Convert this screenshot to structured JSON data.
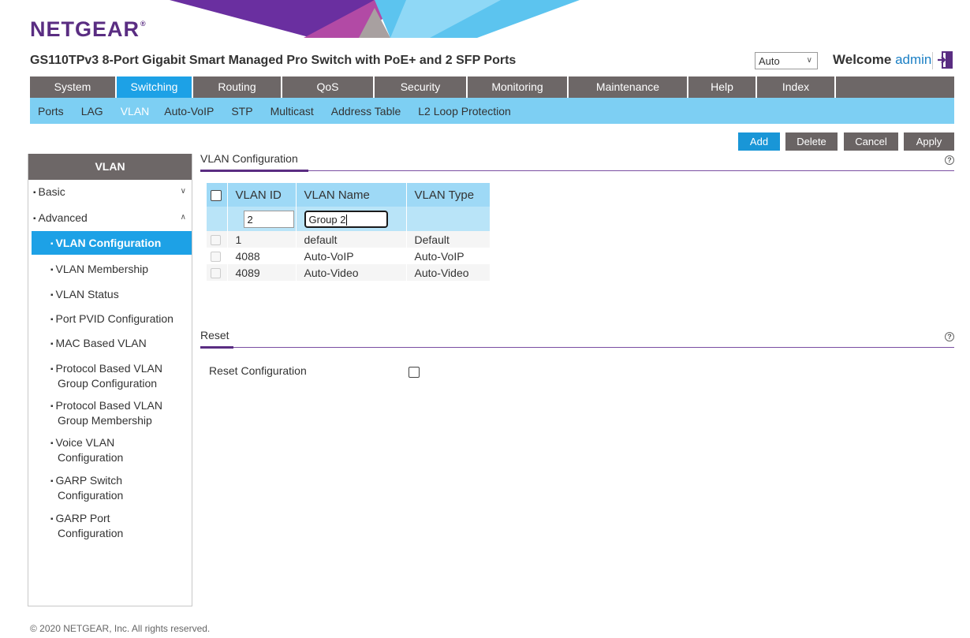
{
  "brand": {
    "logo_text": "NETGEAR",
    "logo_mark": "®",
    "logo_color": "#5a2d82"
  },
  "header": {
    "product_title": "GS110TPv3 8-Port Gigabit Smart Managed Pro Switch with PoE+ and 2 SFP Ports",
    "language_selected": "Auto",
    "welcome_label": "Welcome",
    "user": "admin",
    "logout_icon": "logout-icon"
  },
  "main_nav": {
    "tabs": [
      {
        "label": "System",
        "active": false
      },
      {
        "label": "Switching",
        "active": true
      },
      {
        "label": "Routing",
        "active": false
      },
      {
        "label": "QoS",
        "active": false
      },
      {
        "label": "Security",
        "active": false
      },
      {
        "label": "Monitoring",
        "active": false
      },
      {
        "label": "Maintenance",
        "active": false
      },
      {
        "label": "Help",
        "active": false
      },
      {
        "label": "Index",
        "active": false
      }
    ]
  },
  "sub_nav": {
    "items": [
      {
        "label": "Ports",
        "active": false
      },
      {
        "label": "LAG",
        "active": false
      },
      {
        "label": "VLAN",
        "active": true
      },
      {
        "label": "Auto-VoIP",
        "active": false
      },
      {
        "label": "STP",
        "active": false
      },
      {
        "label": "Multicast",
        "active": false
      },
      {
        "label": "Address Table",
        "active": false
      },
      {
        "label": "L2 Loop Protection",
        "active": false
      }
    ]
  },
  "actions": {
    "add": "Add",
    "delete": "Delete",
    "cancel": "Cancel",
    "apply": "Apply"
  },
  "sidebar": {
    "title": "VLAN",
    "groups": {
      "basic": {
        "label": "Basic",
        "expanded": false
      },
      "advanced": {
        "label": "Advanced",
        "expanded": true
      }
    },
    "items": [
      {
        "label": "VLAN Configuration",
        "active": true
      },
      {
        "label": "VLAN Membership"
      },
      {
        "label": "VLAN Status"
      },
      {
        "label": "Port PVID Configuration"
      },
      {
        "label": "MAC Based VLAN"
      },
      {
        "label": "Protocol Based VLAN Group Configuration"
      },
      {
        "label": "Protocol Based VLAN Group Membership"
      },
      {
        "label": "Voice VLAN Configuration"
      },
      {
        "label": "GARP Switch Configuration"
      },
      {
        "label": "GARP Port Configuration"
      }
    ]
  },
  "vlan_config": {
    "title": "VLAN Configuration",
    "columns": [
      "VLAN ID",
      "VLAN Name",
      "VLAN Type"
    ],
    "new_entry": {
      "vlan_id": "2",
      "vlan_name": "Group 2"
    },
    "rows": [
      {
        "id": "1",
        "name": "default",
        "type": "Default"
      },
      {
        "id": "4088",
        "name": "Auto-VoIP",
        "type": "Auto-VoIP"
      },
      {
        "id": "4089",
        "name": "Auto-Video",
        "type": "Auto-Video"
      }
    ]
  },
  "reset": {
    "title": "Reset",
    "label": "Reset Configuration",
    "checked": false
  },
  "footer": {
    "copyright": "© 2020 NETGEAR, Inc. All rights reserved."
  },
  "colors": {
    "nav_bg": "#6d6767",
    "active_blue": "#1da1e6",
    "subnav_bg": "#7dcff3",
    "table_header": "#9ed9f6",
    "accent_purple": "#5a2d82"
  }
}
